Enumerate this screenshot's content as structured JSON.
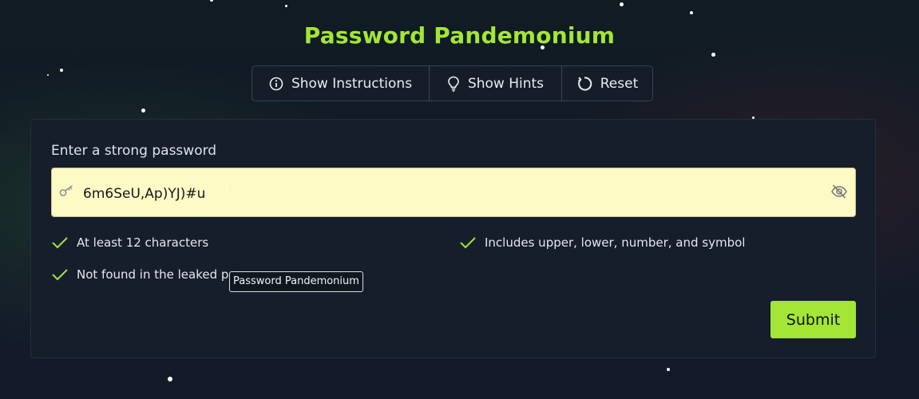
{
  "app": {
    "title": "Password Pandemonium"
  },
  "toolbar": {
    "instructions_label": "Show Instructions",
    "instructions_icon": "info-circle-icon",
    "hints_label": "Show Hints",
    "hints_icon": "lightbulb-icon",
    "reset_label": "Reset",
    "reset_icon": "refresh-icon"
  },
  "form": {
    "label": "Enter a strong password",
    "password_value": "6m6SeU,Ap)YJ)#u",
    "leading_icon": "key-icon",
    "visibility_icon": "eye-off-icon",
    "submit_label": "Submit"
  },
  "requirements": [
    {
      "text": "At least 12 characters",
      "met": true
    },
    {
      "text": "Includes upper, lower, number, and symbol",
      "met": true
    },
    {
      "text": "Not found in the leaked pa",
      "met": true
    }
  ],
  "tooltip": {
    "text": "Password Pandemonium"
  },
  "colors": {
    "accent": "#a3e635",
    "input_background": "#fefac4",
    "check": "#a3e635",
    "panel": "#161d2b"
  }
}
